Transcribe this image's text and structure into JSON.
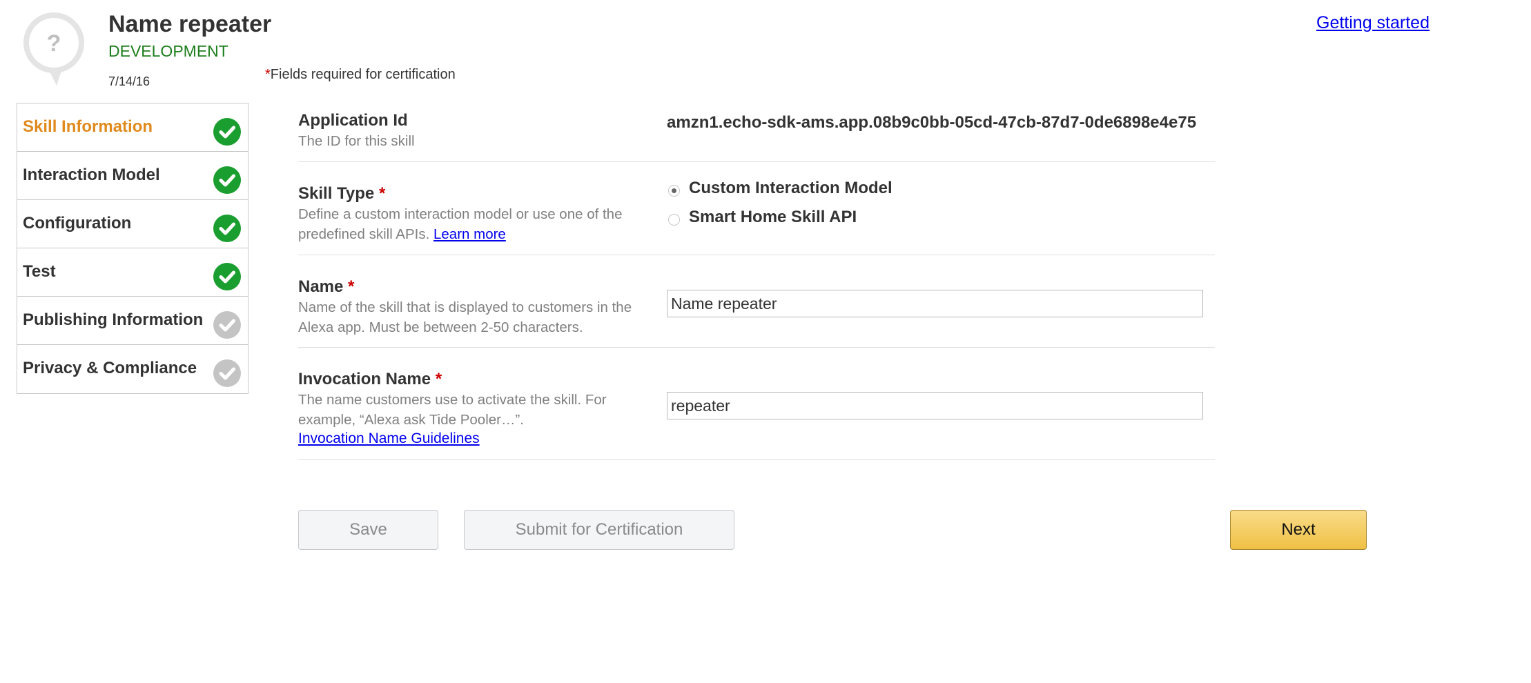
{
  "header": {
    "icon": "question-mark-speech-bubble-icon",
    "title": "Name repeater",
    "status": "DEVELOPMENT",
    "date": "7/14/16",
    "required_star": "*",
    "required_note": "Fields required for certification",
    "getting_started_link": "Getting started"
  },
  "sidebar": {
    "items": [
      {
        "label": "Skill Information",
        "state": "complete",
        "active": true
      },
      {
        "label": "Interaction Model",
        "state": "complete",
        "active": false
      },
      {
        "label": "Configuration",
        "state": "complete",
        "active": false
      },
      {
        "label": "Test",
        "state": "complete",
        "active": false
      },
      {
        "label": "Publishing Information",
        "state": "incomplete",
        "active": false
      },
      {
        "label": "Privacy & Compliance",
        "state": "incomplete",
        "active": false
      }
    ]
  },
  "form": {
    "application_id": {
      "label": "Application Id",
      "description": "The ID for this skill",
      "value": "amzn1.echo-sdk-ams.app.08b9c0bb-05cd-47cb-87d7-0de6898e4e75"
    },
    "skill_type": {
      "label": "Skill Type",
      "required_star": "*",
      "description": "Define a custom interaction model or use one of the predefined skill APIs.",
      "learn_more": "Learn more",
      "options": [
        {
          "label": "Custom Interaction Model",
          "selected": true
        },
        {
          "label": "Smart Home Skill API",
          "selected": false
        }
      ]
    },
    "name": {
      "label": "Name",
      "required_star": "*",
      "description": "Name of the skill that is displayed to customers in the Alexa app. Must be between 2-50 characters.",
      "value": "Name repeater"
    },
    "invocation_name": {
      "label": "Invocation Name",
      "required_star": "*",
      "description": "The name customers use to activate the skill. For example, “Alexa ask Tide Pooler…”.",
      "guidelines_link": "Invocation Name Guidelines",
      "value": "repeater"
    }
  },
  "buttons": {
    "save": "Save",
    "submit": "Submit for Certification",
    "next": "Next"
  },
  "colors": {
    "active_nav": "#e08a1e",
    "complete_check": "#1a9e2f",
    "pending_check": "#c4c4c4",
    "status_green": "#1e7e1e",
    "required_red": "#cc0000",
    "next_button": "#efc044"
  }
}
